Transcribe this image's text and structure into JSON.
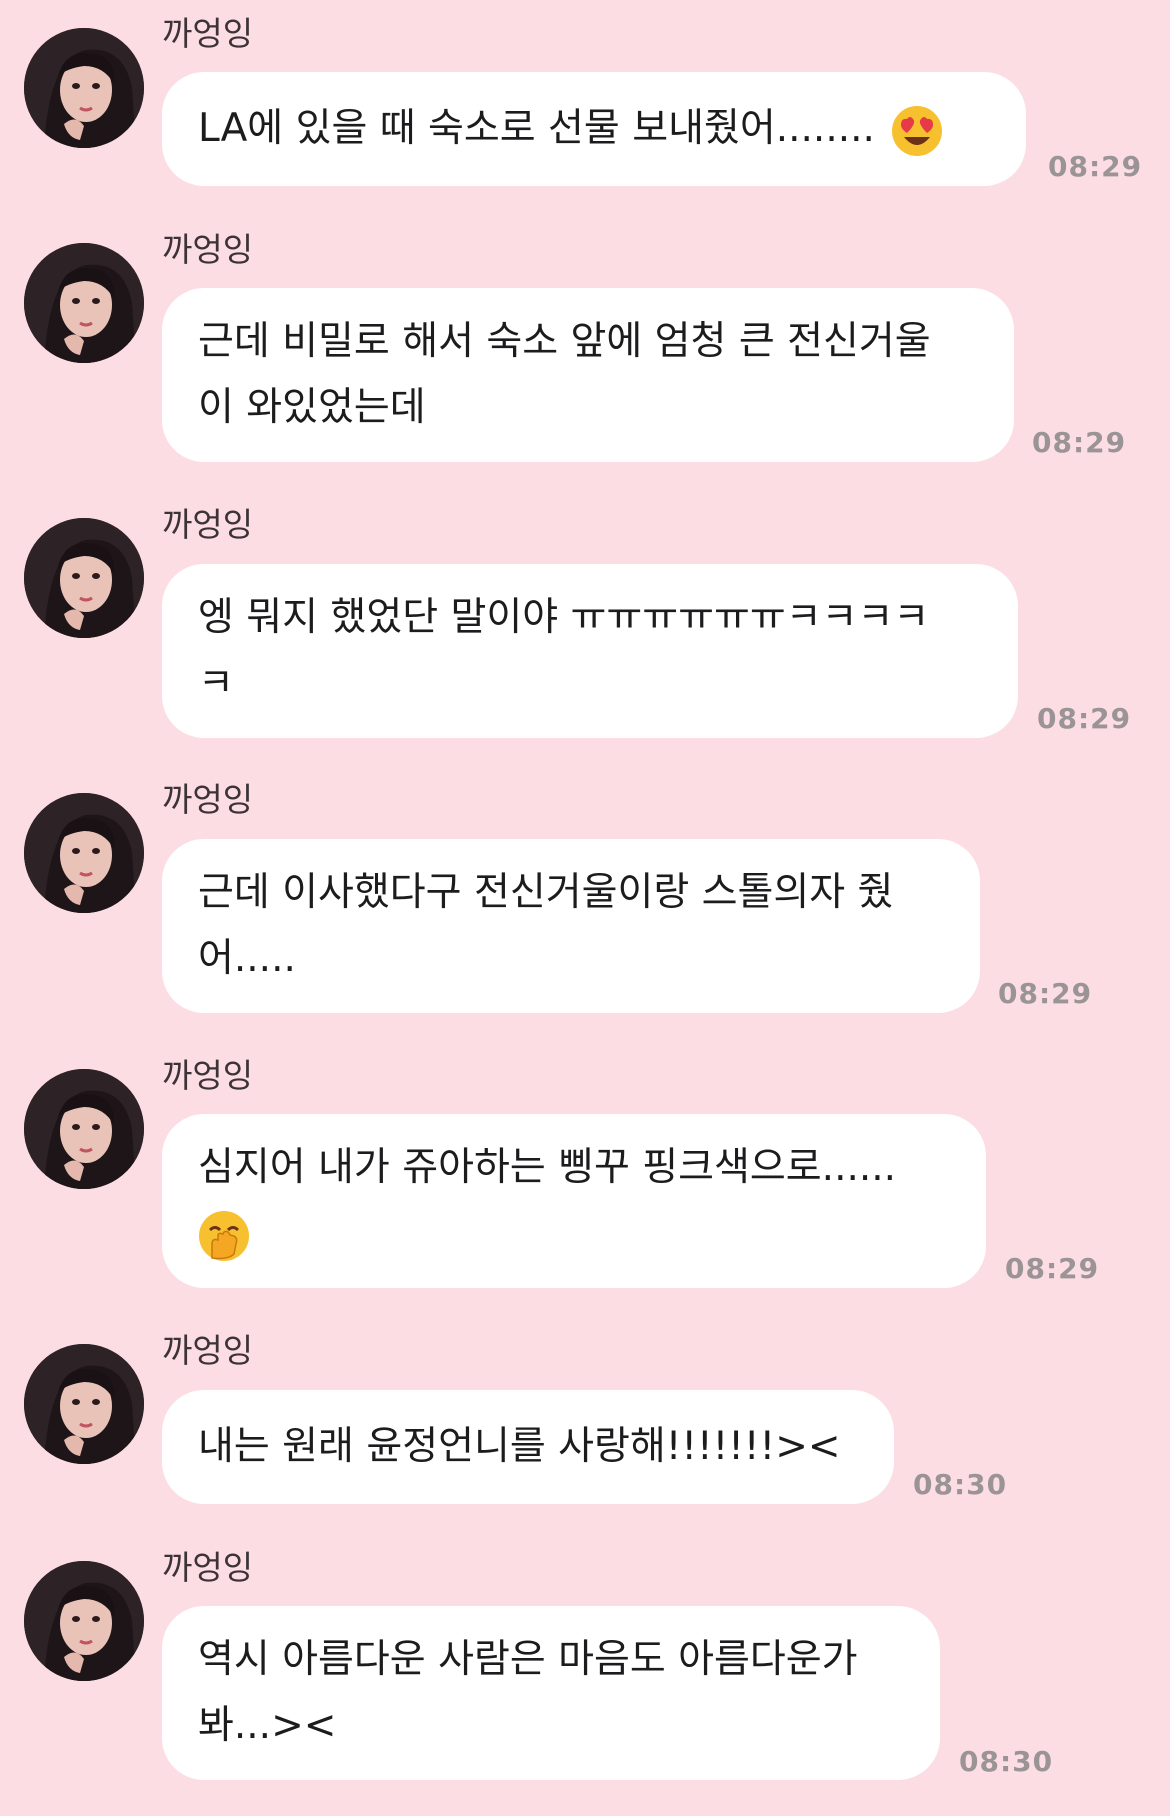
{
  "messages": [
    {
      "sender": "까엉잉",
      "lines": [
        "LA에 있을 때 숙소로 선물 보내줬어........"
      ],
      "emoji": "heart-eyes-emoji",
      "time": "08:29"
    },
    {
      "sender": "까엉잉",
      "lines": [
        "근데 비밀로 해서 숙소 앞에 엄청 큰 전신거울",
        "이 와있었는데"
      ],
      "time": "08:29"
    },
    {
      "sender": "까엉잉",
      "lines": [
        "엥 뭐지 했었단 말이야 ㅠㅠㅠㅠㅠㅠㅋㅋㅋㅋ",
        "ㅋ"
      ],
      "time": "08:29"
    },
    {
      "sender": "까엉잉",
      "lines": [
        "근데 이사했다구 전신거울이랑 스톨의자 줬",
        "어....."
      ],
      "time": "08:29"
    },
    {
      "sender": "까엉잉",
      "lines": [
        "심지어 내가 쥬아하는 삥꾸 핑크색으로......"
      ],
      "emoji": "hand-over-mouth-emoji",
      "time": "08:29"
    },
    {
      "sender": "까엉잉",
      "lines": [
        "내는 원래 윤정언니를 사랑해!!!!!!!><"
      ],
      "time": "08:30"
    },
    {
      "sender": "까엉잉",
      "lines": [
        "역시 아름다운 사람은 마음도 아름다운가",
        "봐...><"
      ],
      "time": "08:30"
    }
  ],
  "colors": {
    "background": "#fddde4",
    "bubble": "#ffffff",
    "time": "#9a9496",
    "sender": "#3b3338"
  }
}
